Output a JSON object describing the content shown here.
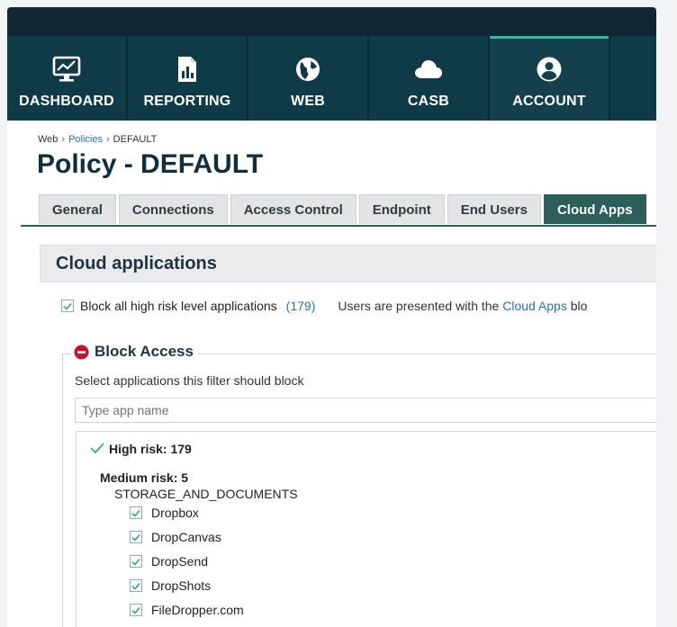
{
  "nav": {
    "items": [
      {
        "label": "DASHBOARD",
        "icon": "monitor-chart-icon"
      },
      {
        "label": "REPORTING",
        "icon": "report-icon"
      },
      {
        "label": "WEB",
        "icon": "globe-icon"
      },
      {
        "label": "CASB",
        "icon": "cloud-icon"
      },
      {
        "label": "ACCOUNT",
        "icon": "user-circle-icon"
      }
    ],
    "active": "ACCOUNT"
  },
  "breadcrumb": {
    "root": "Web",
    "policies": "Policies",
    "current": "DEFAULT"
  },
  "page": {
    "title": "Policy - DEFAULT"
  },
  "tabs": [
    "General",
    "Connections",
    "Access Control",
    "Endpoint",
    "End Users",
    "Cloud Apps"
  ],
  "active_tab": "Cloud Apps",
  "section": {
    "title": "Cloud applications"
  },
  "block_all": {
    "label": "Block all high risk level applications",
    "count": "(179)",
    "info_prefix": "Users are presented with the ",
    "info_link": "Cloud Apps",
    "info_suffix": " blo"
  },
  "block_access": {
    "title": "Block Access",
    "hint": "Select applications this filter should block",
    "search_placeholder": "Type app name",
    "high_risk_label": "High risk:",
    "high_risk_count": "179",
    "medium_risk_label": "Medium risk: 5",
    "category": "STORAGE_AND_DOCUMENTS",
    "apps": [
      "Dropbox",
      "DropCanvas",
      "DropSend",
      "DropShots",
      "FileDropper.com"
    ]
  },
  "colors": {
    "nav_bg": "#0f3a47",
    "accent": "#2d5f5a",
    "link": "#2a6fb6",
    "stop_red": "#c8102e"
  }
}
